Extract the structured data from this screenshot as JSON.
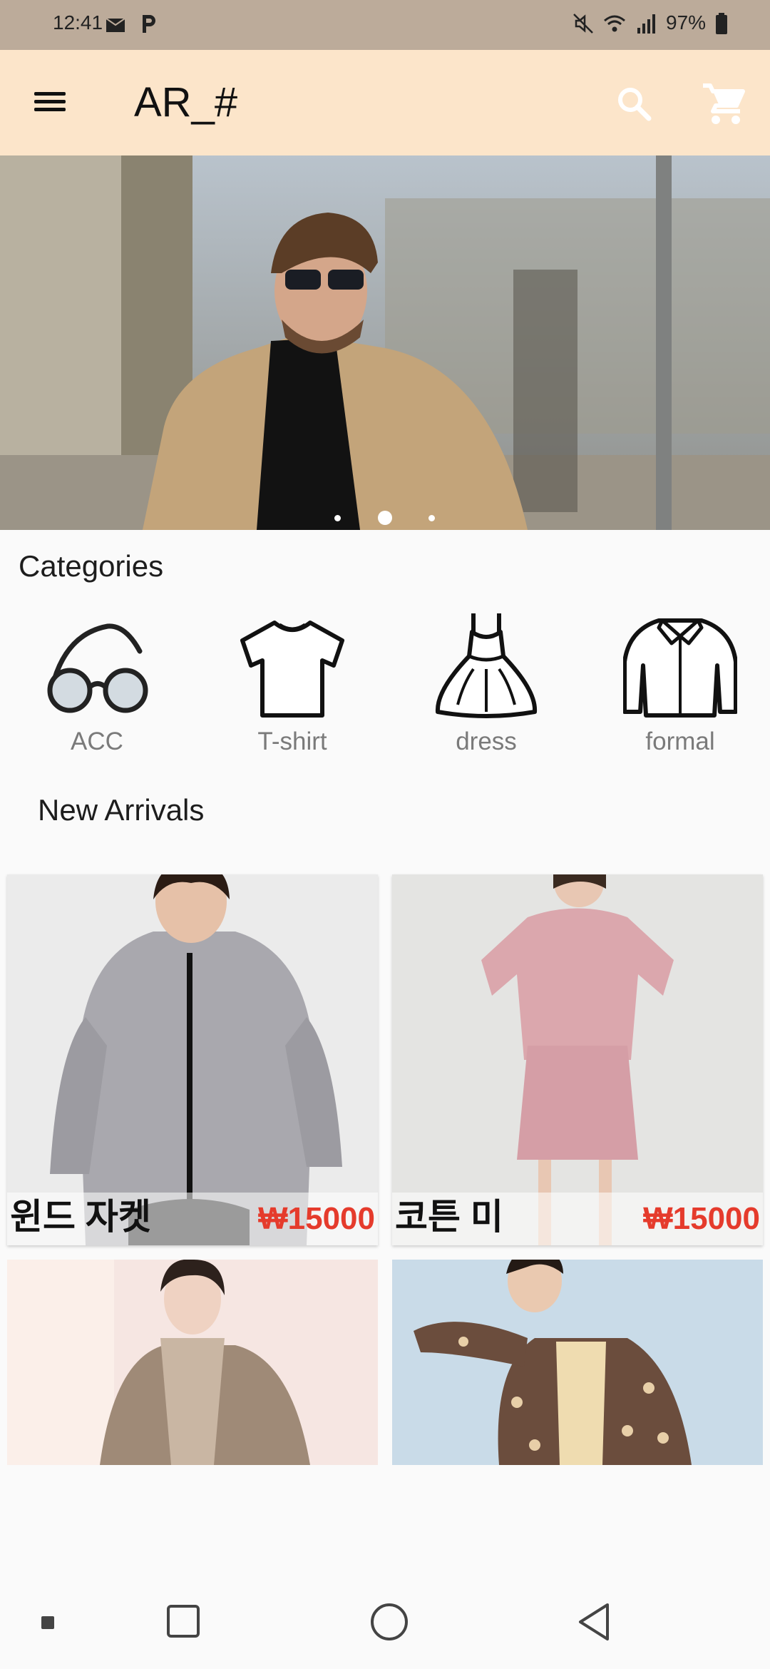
{
  "status_bar": {
    "time": "12:41",
    "battery": "97%",
    "icons": [
      "mail-icon",
      "parking-icon",
      "mute-icon",
      "wifi-icon",
      "signal-icon",
      "battery-icon"
    ]
  },
  "app_bar": {
    "title": "AR_#",
    "icons": [
      "menu-icon",
      "search-icon",
      "cart-icon"
    ],
    "background": "#fce5ca"
  },
  "banner": {
    "slide_count": 3,
    "active_slide": 2
  },
  "categories": {
    "title": "Categories",
    "items": [
      {
        "label": "ACC",
        "icon": "glasses-icon"
      },
      {
        "label": "T-shirt",
        "icon": "tshirt-icon"
      },
      {
        "label": "dress",
        "icon": "dress-icon"
      },
      {
        "label": "formal",
        "icon": "formal-shirt-icon"
      }
    ]
  },
  "new_arrivals": {
    "title": "New Arrivals",
    "products": [
      {
        "name": "윈드 자켓",
        "price": "₩15000"
      },
      {
        "name": "코튼 미",
        "price": "₩15000"
      },
      {
        "name": "",
        "price": ""
      },
      {
        "name": "",
        "price": ""
      }
    ]
  },
  "colors": {
    "accent": "#fce5ca",
    "price": "#e53b2c"
  }
}
